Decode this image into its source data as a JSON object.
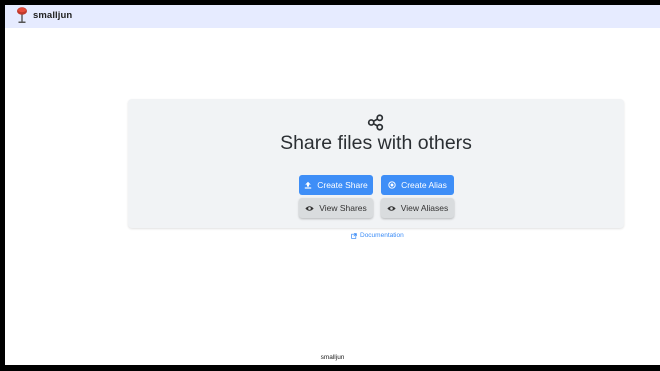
{
  "navbar": {
    "brand": "smalljun"
  },
  "hero": {
    "title": "Share files with others",
    "buttons": {
      "create_share": "Create Share",
      "create_alias": "Create Alias",
      "view_shares": "View Shares",
      "view_aliases": "View Aliases"
    }
  },
  "links": {
    "documentation": "Documentation"
  },
  "footer": {
    "text": "smalljun"
  },
  "colors": {
    "primary": "#3e8ef7",
    "navbar": "#e6ebff",
    "hero_bg": "#f1f3f5"
  }
}
